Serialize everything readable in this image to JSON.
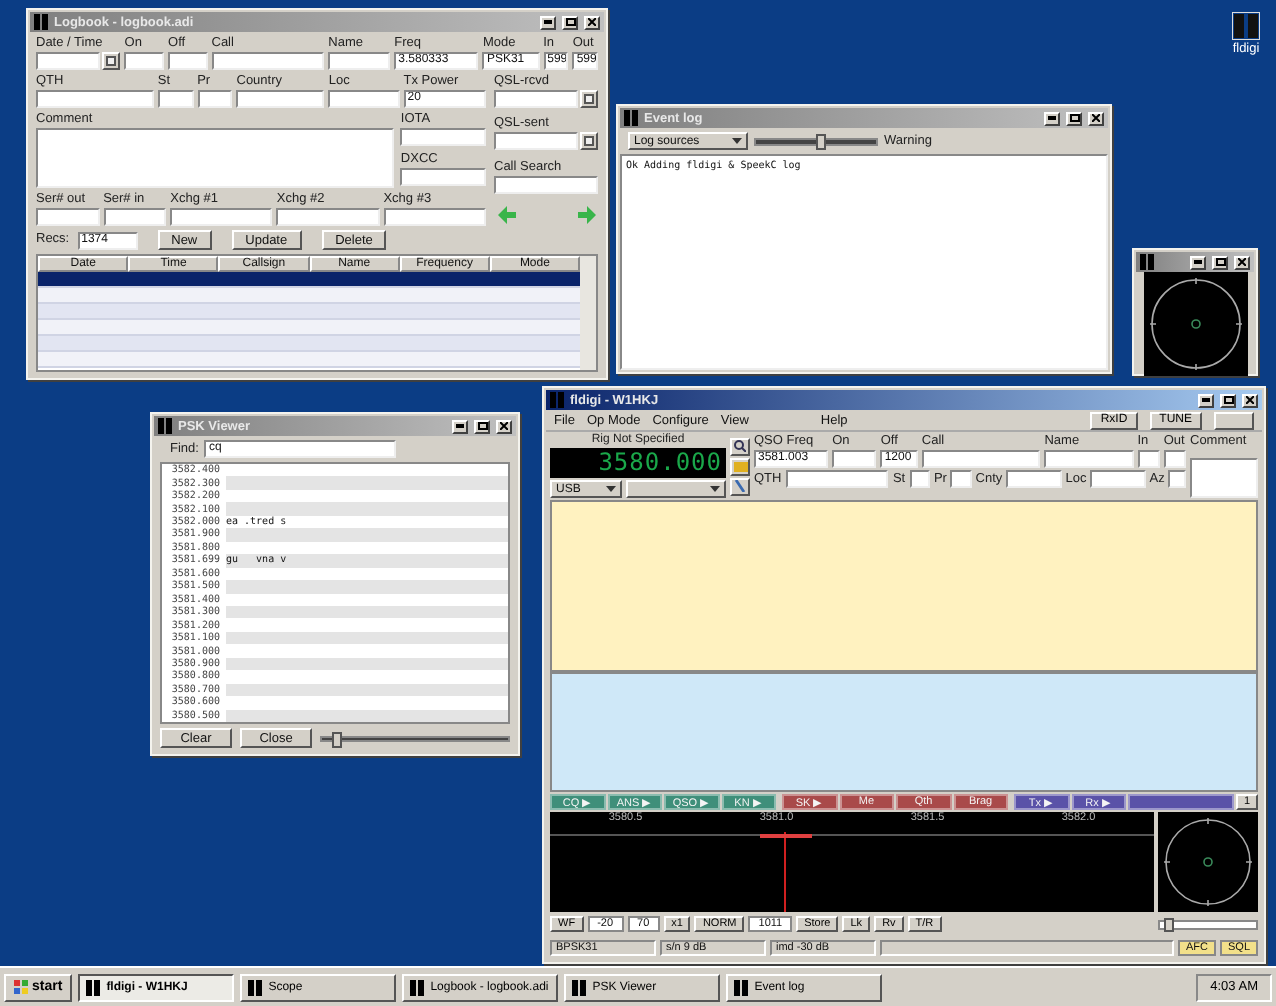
{
  "desktop_icon": {
    "label": "fldigi"
  },
  "logbook": {
    "title": "Logbook - logbook.adi",
    "row1": [
      {
        "label": "Date / Time",
        "kind": "picker"
      },
      {
        "label": "On",
        "kind": "text"
      },
      {
        "label": "Off",
        "kind": "text"
      },
      {
        "label": "Call",
        "kind": "text"
      },
      {
        "label": "Name",
        "kind": "text"
      },
      {
        "label": "Freq",
        "kind": "text",
        "value": "3.580333"
      },
      {
        "label": "Mode",
        "kind": "text",
        "value": "PSK31"
      },
      {
        "label": "In",
        "kind": "text",
        "value": "599"
      },
      {
        "label": "Out",
        "kind": "text",
        "value": "599"
      }
    ],
    "row2": [
      {
        "label": "QTH"
      },
      {
        "label": "St"
      },
      {
        "label": "Pr"
      },
      {
        "label": "Country"
      },
      {
        "label": "Loc"
      },
      {
        "label": "Tx Power",
        "value": "20"
      }
    ],
    "comment": {
      "label": "Comment"
    },
    "side": [
      {
        "label": "IOTA"
      },
      {
        "label": "DXCC"
      }
    ],
    "serial": [
      {
        "label": "Ser# out"
      },
      {
        "label": "Ser# in"
      },
      {
        "label": "Xchg #1"
      },
      {
        "label": "Xchg #2"
      },
      {
        "label": "Xchg #3"
      }
    ],
    "right": [
      {
        "label": "QSL-rcvd",
        "kind": "picker"
      },
      {
        "label": "QSL-sent",
        "kind": "picker"
      },
      {
        "label": "Call Search",
        "kind": "text"
      }
    ],
    "recs_label": "Recs:",
    "recs": "1374",
    "buttons": [
      "New",
      "Update",
      "Delete"
    ],
    "columns": [
      "Date",
      "Time",
      "Callsign",
      "Name",
      "Frequency",
      "Mode"
    ],
    "rows": [
      {
        "selected": true
      },
      {
        "selected": false
      },
      {
        "selected": false
      },
      {
        "selected": false
      },
      {
        "selected": false
      },
      {
        "selected": false
      }
    ]
  },
  "event_log": {
    "title": "Event log",
    "source": "Log sources",
    "level": 0.55,
    "level_label": "Warning",
    "lines": [
      "Ok Adding fldigi & SpeekC log"
    ]
  },
  "psk_viewer": {
    "title": "PSK Viewer",
    "find_label": "Find:",
    "find": "cq",
    "rows": [
      {
        "freq": "3582.400"
      },
      {
        "freq": "3582.300"
      },
      {
        "freq": "3582.200"
      },
      {
        "freq": "3582.100"
      },
      {
        "freq": "3582.000",
        "text": "ea .tred s"
      },
      {
        "freq": "3581.900"
      },
      {
        "freq": "3581.800"
      },
      {
        "freq": "3581.699",
        "text": "gu   vna v"
      },
      {
        "freq": "3581.600"
      },
      {
        "freq": "3581.500"
      },
      {
        "freq": "3581.400"
      },
      {
        "freq": "3581.300"
      },
      {
        "freq": "3581.200"
      },
      {
        "freq": "3581.100"
      },
      {
        "freq": "3581.000"
      },
      {
        "freq": "3580.900"
      },
      {
        "freq": "3580.800"
      },
      {
        "freq": "3580.700"
      },
      {
        "freq": "3580.600"
      },
      {
        "freq": "3580.500"
      }
    ],
    "buttons": [
      "Clear",
      "Close"
    ],
    "level": 0.05
  },
  "fldigi": {
    "title": "fldigi - W1HKJ",
    "menu": [
      "File",
      "Op Mode",
      "Configure",
      "View",
      "Help"
    ],
    "toggles": [
      "RxID",
      "TUNE"
    ],
    "rig": "Rig Not Specified",
    "frequency": "3580.000",
    "mode": "USB",
    "row1": [
      {
        "label": "QSO Freq",
        "value": "3581.003"
      },
      {
        "label": "On"
      },
      {
        "label": "Off",
        "value": "1200"
      },
      {
        "label": "Call"
      },
      {
        "label": "Name"
      },
      {
        "label": "In"
      },
      {
        "label": "Out"
      }
    ],
    "comment_label": "Comment",
    "row2": [
      {
        "label": "QTH"
      },
      {
        "label": "St"
      },
      {
        "label": "Pr"
      },
      {
        "label": "Cnty"
      },
      {
        "label": "Loc"
      },
      {
        "label": "Az"
      }
    ],
    "macros": [
      {
        "label": "CQ ▶",
        "color": "#3f8f7a"
      },
      {
        "label": "ANS ▶",
        "color": "#3f8f7a"
      },
      {
        "label": "QSO ▶",
        "color": "#3f8f7a"
      },
      {
        "label": "KN ▶",
        "color": "#3f8f7a"
      },
      {
        "label": "SK ▶",
        "color": "#a94a4a"
      },
      {
        "label": "Me",
        "color": "#a94a4a"
      },
      {
        "label": "Qth",
        "color": "#a94a4a"
      },
      {
        "label": "Brag",
        "color": "#a94a4a"
      },
      {
        "label": "Tx ▶",
        "color": "#5a52a8"
      },
      {
        "label": "Rx ▶",
        "color": "#5a52a8"
      }
    ],
    "macro_set": "1",
    "scale": [
      "3580.5",
      "3581.0",
      "3581.5",
      "3582.0"
    ],
    "controls": [
      {
        "kind": "button",
        "label": "WF"
      },
      {
        "kind": "value",
        "label": "-20"
      },
      {
        "kind": "value",
        "label": "70"
      },
      {
        "kind": "button",
        "label": "x1"
      },
      {
        "kind": "button",
        "label": "NORM"
      },
      {
        "kind": "value",
        "label": "1011"
      },
      {
        "kind": "button",
        "label": "Store"
      },
      {
        "kind": "button",
        "label": "Lk"
      },
      {
        "kind": "button",
        "label": "Rv"
      },
      {
        "kind": "button",
        "label": "T/R"
      }
    ],
    "squelch": {
      "level": 0.05
    },
    "status": [
      "BPSK31",
      "s/n  9 dB",
      "imd -30 dB"
    ],
    "indicators": [
      {
        "label": "AFC",
        "on": true
      },
      {
        "label": "SQL",
        "on": true
      }
    ]
  },
  "taskbar": {
    "start": "start",
    "items": [
      {
        "label": "fldigi - W1HKJ",
        "selected": true
      },
      {
        "label": "Scope",
        "selected": false
      },
      {
        "label": "Logbook - logbook.adi",
        "selected": false
      },
      {
        "label": "PSK Viewer",
        "selected": false
      },
      {
        "label": "Event log",
        "selected": false
      }
    ],
    "clock": "4:03 AM"
  }
}
